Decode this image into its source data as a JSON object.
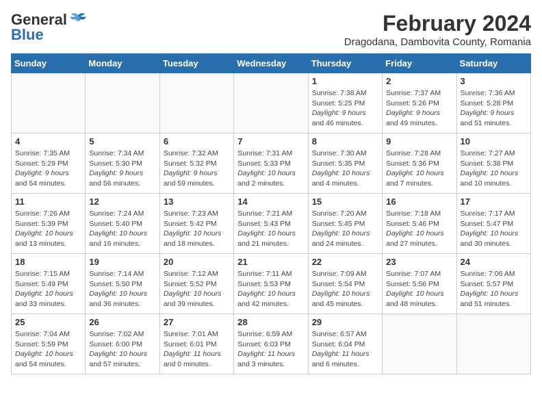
{
  "header": {
    "logo_general": "General",
    "logo_blue": "Blue",
    "month_year": "February 2024",
    "location": "Dragodana, Dambovita County, Romania"
  },
  "weekdays": [
    "Sunday",
    "Monday",
    "Tuesday",
    "Wednesday",
    "Thursday",
    "Friday",
    "Saturday"
  ],
  "weeks": [
    [
      {
        "day": "",
        "content": ""
      },
      {
        "day": "",
        "content": ""
      },
      {
        "day": "",
        "content": ""
      },
      {
        "day": "",
        "content": ""
      },
      {
        "day": "1",
        "content": "Sunrise: 7:38 AM\nSunset: 5:25 PM\nDaylight: 9 hours\nand 46 minutes."
      },
      {
        "day": "2",
        "content": "Sunrise: 7:37 AM\nSunset: 5:26 PM\nDaylight: 9 hours\nand 49 minutes."
      },
      {
        "day": "3",
        "content": "Sunrise: 7:36 AM\nSunset: 5:28 PM\nDaylight: 9 hours\nand 51 minutes."
      }
    ],
    [
      {
        "day": "4",
        "content": "Sunrise: 7:35 AM\nSunset: 5:29 PM\nDaylight: 9 hours\nand 54 minutes."
      },
      {
        "day": "5",
        "content": "Sunrise: 7:34 AM\nSunset: 5:30 PM\nDaylight: 9 hours\nand 56 minutes."
      },
      {
        "day": "6",
        "content": "Sunrise: 7:32 AM\nSunset: 5:32 PM\nDaylight: 9 hours\nand 59 minutes."
      },
      {
        "day": "7",
        "content": "Sunrise: 7:31 AM\nSunset: 5:33 PM\nDaylight: 10 hours\nand 2 minutes."
      },
      {
        "day": "8",
        "content": "Sunrise: 7:30 AM\nSunset: 5:35 PM\nDaylight: 10 hours\nand 4 minutes."
      },
      {
        "day": "9",
        "content": "Sunrise: 7:28 AM\nSunset: 5:36 PM\nDaylight: 10 hours\nand 7 minutes."
      },
      {
        "day": "10",
        "content": "Sunrise: 7:27 AM\nSunset: 5:38 PM\nDaylight: 10 hours\nand 10 minutes."
      }
    ],
    [
      {
        "day": "11",
        "content": "Sunrise: 7:26 AM\nSunset: 5:39 PM\nDaylight: 10 hours\nand 13 minutes."
      },
      {
        "day": "12",
        "content": "Sunrise: 7:24 AM\nSunset: 5:40 PM\nDaylight: 10 hours\nand 16 minutes."
      },
      {
        "day": "13",
        "content": "Sunrise: 7:23 AM\nSunset: 5:42 PM\nDaylight: 10 hours\nand 18 minutes."
      },
      {
        "day": "14",
        "content": "Sunrise: 7:21 AM\nSunset: 5:43 PM\nDaylight: 10 hours\nand 21 minutes."
      },
      {
        "day": "15",
        "content": "Sunrise: 7:20 AM\nSunset: 5:45 PM\nDaylight: 10 hours\nand 24 minutes."
      },
      {
        "day": "16",
        "content": "Sunrise: 7:18 AM\nSunset: 5:46 PM\nDaylight: 10 hours\nand 27 minutes."
      },
      {
        "day": "17",
        "content": "Sunrise: 7:17 AM\nSunset: 5:47 PM\nDaylight: 10 hours\nand 30 minutes."
      }
    ],
    [
      {
        "day": "18",
        "content": "Sunrise: 7:15 AM\nSunset: 5:49 PM\nDaylight: 10 hours\nand 33 minutes."
      },
      {
        "day": "19",
        "content": "Sunrise: 7:14 AM\nSunset: 5:50 PM\nDaylight: 10 hours\nand 36 minutes."
      },
      {
        "day": "20",
        "content": "Sunrise: 7:12 AM\nSunset: 5:52 PM\nDaylight: 10 hours\nand 39 minutes."
      },
      {
        "day": "21",
        "content": "Sunrise: 7:11 AM\nSunset: 5:53 PM\nDaylight: 10 hours\nand 42 minutes."
      },
      {
        "day": "22",
        "content": "Sunrise: 7:09 AM\nSunset: 5:54 PM\nDaylight: 10 hours\nand 45 minutes."
      },
      {
        "day": "23",
        "content": "Sunrise: 7:07 AM\nSunset: 5:56 PM\nDaylight: 10 hours\nand 48 minutes."
      },
      {
        "day": "24",
        "content": "Sunrise: 7:06 AM\nSunset: 5:57 PM\nDaylight: 10 hours\nand 51 minutes."
      }
    ],
    [
      {
        "day": "25",
        "content": "Sunrise: 7:04 AM\nSunset: 5:59 PM\nDaylight: 10 hours\nand 54 minutes."
      },
      {
        "day": "26",
        "content": "Sunrise: 7:02 AM\nSunset: 6:00 PM\nDaylight: 10 hours\nand 57 minutes."
      },
      {
        "day": "27",
        "content": "Sunrise: 7:01 AM\nSunset: 6:01 PM\nDaylight: 11 hours\nand 0 minutes."
      },
      {
        "day": "28",
        "content": "Sunrise: 6:59 AM\nSunset: 6:03 PM\nDaylight: 11 hours\nand 3 minutes."
      },
      {
        "day": "29",
        "content": "Sunrise: 6:57 AM\nSunset: 6:04 PM\nDaylight: 11 hours\nand 6 minutes."
      },
      {
        "day": "",
        "content": ""
      },
      {
        "day": "",
        "content": ""
      }
    ]
  ]
}
